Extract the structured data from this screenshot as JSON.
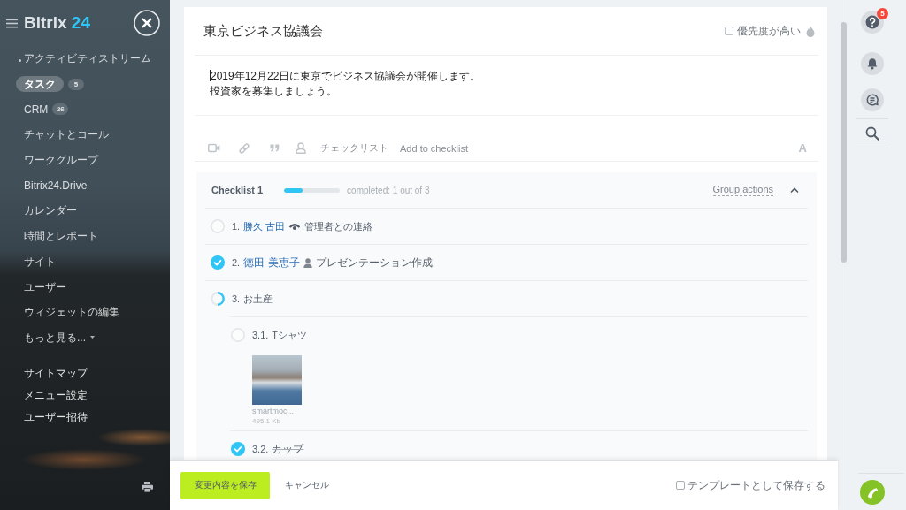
{
  "sidebar": {
    "logo": {
      "name": "Bitrix",
      "number": "24"
    },
    "menu": [
      {
        "label": "アクティビティストリーム",
        "selected": false,
        "dot": true
      },
      {
        "label": "タスク",
        "selected": true,
        "dot": false,
        "counter": "5"
      },
      {
        "label": "CRM",
        "selected": false,
        "dot": false,
        "counter": "26"
      },
      {
        "label": "チャットとコール",
        "selected": false,
        "dot": false
      },
      {
        "label": "ワークグループ",
        "selected": false,
        "dot": false
      },
      {
        "label": "Bitrix24.Drive",
        "selected": false,
        "dot": false
      },
      {
        "label": "カレンダー",
        "selected": false,
        "dot": false
      },
      {
        "label": "時間とレポート",
        "selected": false,
        "dot": false
      },
      {
        "label": "サイト",
        "selected": false,
        "dot": false
      },
      {
        "label": "ユーザー",
        "selected": false,
        "dot": false
      },
      {
        "label": "ウィジェットの編集",
        "selected": false,
        "dot": false
      }
    ],
    "more": "もっと見る...",
    "links": [
      "サイトマップ",
      "メニュー設定",
      "ユーザー招待"
    ]
  },
  "task": {
    "title": "東京ビジネス協議会",
    "priority": {
      "label": "優先度が高い",
      "checked": false
    },
    "description": {
      "lines": [
        "2019年12月22日に東京でビジネス協議会が開催します。",
        "投資家を募集しましょう。"
      ],
      "focused": true
    },
    "toolbar": {
      "checklist": "チェックリスト",
      "add_to_checklist": "Add to checklist",
      "format": "A"
    },
    "checklist": {
      "title": "Checklist 1",
      "level": 0.33,
      "progress_text": "completed: 1 out of 3",
      "group_actions": "Group actions",
      "expanded": true,
      "items": [
        {
          "number": "1.",
          "person": {
            "name": "勝久 古田",
            "kind": "observer"
          },
          "text": "管理者との連絡",
          "checked": false
        },
        {
          "number": "2.",
          "person": {
            "name": "徳田 美恵子",
            "kind": "assignee"
          },
          "text": "プレゼンテーション作成",
          "checked": true
        },
        {
          "number": "3.",
          "text": "お土産",
          "checked": false,
          "level": 0.5,
          "children": [
            {
              "number": "3.1.",
              "text": "Tシャツ",
              "checked": false,
              "attachments": [
                {
                  "name": "smartmoc...",
                  "size": "495.1 Kb"
                }
              ]
            },
            {
              "number": "3.2.",
              "text": "カップ",
              "checked": true
            }
          ]
        }
      ]
    }
  },
  "footer": {
    "save": "変更内容を保存",
    "cancel": "キャンセル",
    "template": {
      "label": "テンプレートとして保存する",
      "checked": false
    }
  },
  "right_bar": {
    "help_badge": "5"
  }
}
